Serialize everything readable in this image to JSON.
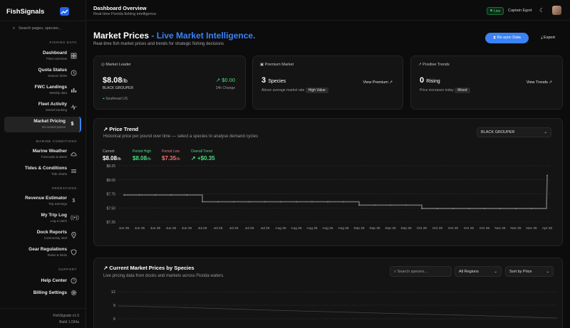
{
  "brand": {
    "name": "FishSignals"
  },
  "sidebar": {
    "search_placeholder": "Search pages, species...",
    "sections": {
      "fishing": "FISHING DATA",
      "marine": "MARINE CONDITIONS",
      "operations": "OPERATIONS",
      "support": "SUPPORT"
    },
    "items": [
      {
        "title": "Dashboard",
        "sub": "Fleet overview",
        "icon": "grid-icon"
      },
      {
        "title": "Quota Status",
        "sub": "Season limits",
        "icon": "clock-icon"
      },
      {
        "title": "FWC Landings",
        "sub": "Weekly data",
        "icon": "bar-chart-icon"
      },
      {
        "title": "Fleet Activity",
        "sub": "Vessel tracking",
        "icon": "pulse-icon"
      },
      {
        "title": "Market Pricing",
        "sub": "Ex-vessel prices",
        "icon": "dollar-icon"
      },
      {
        "title": "Marine Weather",
        "sub": "Forecasts & alerts",
        "icon": "cloud-icon"
      },
      {
        "title": "Tides & Conditions",
        "sub": "Tide charts",
        "icon": "waves-icon"
      },
      {
        "title": "Revenue Estimator",
        "sub": "Trip earnings",
        "icon": "dollar-icon"
      },
      {
        "title": "My Trip Log",
        "sub": "Log a catch",
        "icon": "radio-icon"
      },
      {
        "title": "Dock Reports",
        "sub": "Community intel",
        "icon": "pin-icon"
      },
      {
        "title": "Gear Regulations",
        "sub": "Rules & limits",
        "icon": "shield-icon"
      },
      {
        "title": "Help Center",
        "sub": "",
        "icon": "help-icon"
      },
      {
        "title": "Billing Settings",
        "sub": "",
        "icon": "gear-icon"
      }
    ],
    "version": "FishSignals v1.0",
    "build": "Build 1.034a"
  },
  "header": {
    "title": "Dashboard Overview",
    "subtitle": "Real-time Florida fishing intelligence",
    "live": "Live",
    "user": "Captain Egret"
  },
  "page": {
    "title": "Market Prices",
    "title_accent": " - Live Market Intelligence.",
    "subtitle": "Real-time fish market prices and trends for strategic fishing decisions",
    "resync": "Re-sync Data",
    "export": "Export"
  },
  "cards": {
    "leader": {
      "header": "Market Leader",
      "price": "$8.08",
      "unit": "/lb",
      "species": "BLACK GROUPER",
      "change": "$0.00",
      "change_label": "24h Change",
      "region": "Southeast US"
    },
    "premium": {
      "header": "Premium Market",
      "count": "3",
      "count_label": "Species",
      "note": "Above average market rate",
      "badge": "High Value",
      "action": "View Premium"
    },
    "trends": {
      "header": "Positive Trends",
      "count": "0",
      "count_label": "Rising",
      "note": "Price increases today",
      "badge": "Mixed",
      "action": "View Trends"
    }
  },
  "price_trend": {
    "title": "Price Trend",
    "subtitle": "Historical price per pound over time — select a species to analyse demand cycles",
    "species_select": "BLACK GROUPER",
    "stats": {
      "current_label": "Current",
      "current": "$8.08",
      "current_unit": "/lb",
      "high_label": "Period High",
      "high": "$8.08",
      "high_unit": "/lb",
      "low_label": "Period Low",
      "low": "$7.35",
      "low_unit": "/lb",
      "overall_label": "Overall Trend",
      "overall": "+$0.35"
    }
  },
  "chart_data": {
    "type": "line",
    "title": "",
    "xlabel": "",
    "ylabel": "",
    "ylim": [
      7.25,
      8.25
    ],
    "yticks": [
      "$8.25",
      "$8.00",
      "$7.75",
      "$7.50",
      "$7.25"
    ],
    "grid": true,
    "x_tick_labels": [
      "Jun 25",
      "Jun 25",
      "Jun 25",
      "Jun 25",
      "Jun 25",
      "Jul 25",
      "Jul 25",
      "Jul 25",
      "Jul 25",
      "Jul 25",
      "Aug 25",
      "Aug 25",
      "Aug 25",
      "Aug 25",
      "Aug 25",
      "Sep 25",
      "Sep 25",
      "Sep 25",
      "Sep 25",
      "Oct 25",
      "Oct 25",
      "Oct 25",
      "Oct 25",
      "Oct 25",
      "Nov 25",
      "Nov 25",
      "Nov 25",
      "Apr 26"
    ],
    "series": [
      {
        "values": [
          7.73,
          7.73,
          7.73,
          7.73,
          7.73,
          7.61,
          7.61,
          7.61,
          7.61,
          7.61,
          7.61,
          7.61,
          7.61,
          7.61,
          7.61,
          7.55,
          7.55,
          7.55,
          7.55,
          7.49,
          7.49,
          7.49,
          7.49,
          7.49,
          7.49,
          7.49,
          7.49,
          8.08
        ]
      }
    ]
  },
  "species_table": {
    "title": "Current Market Prices by Species",
    "subtitle": "Live pricing data from docks and markets across Florida waters.",
    "search_placeholder": "Search species...",
    "region_select": "All Regions",
    "sort_select": "Sort by Price",
    "yticks": [
      "12",
      "9",
      "6"
    ]
  }
}
